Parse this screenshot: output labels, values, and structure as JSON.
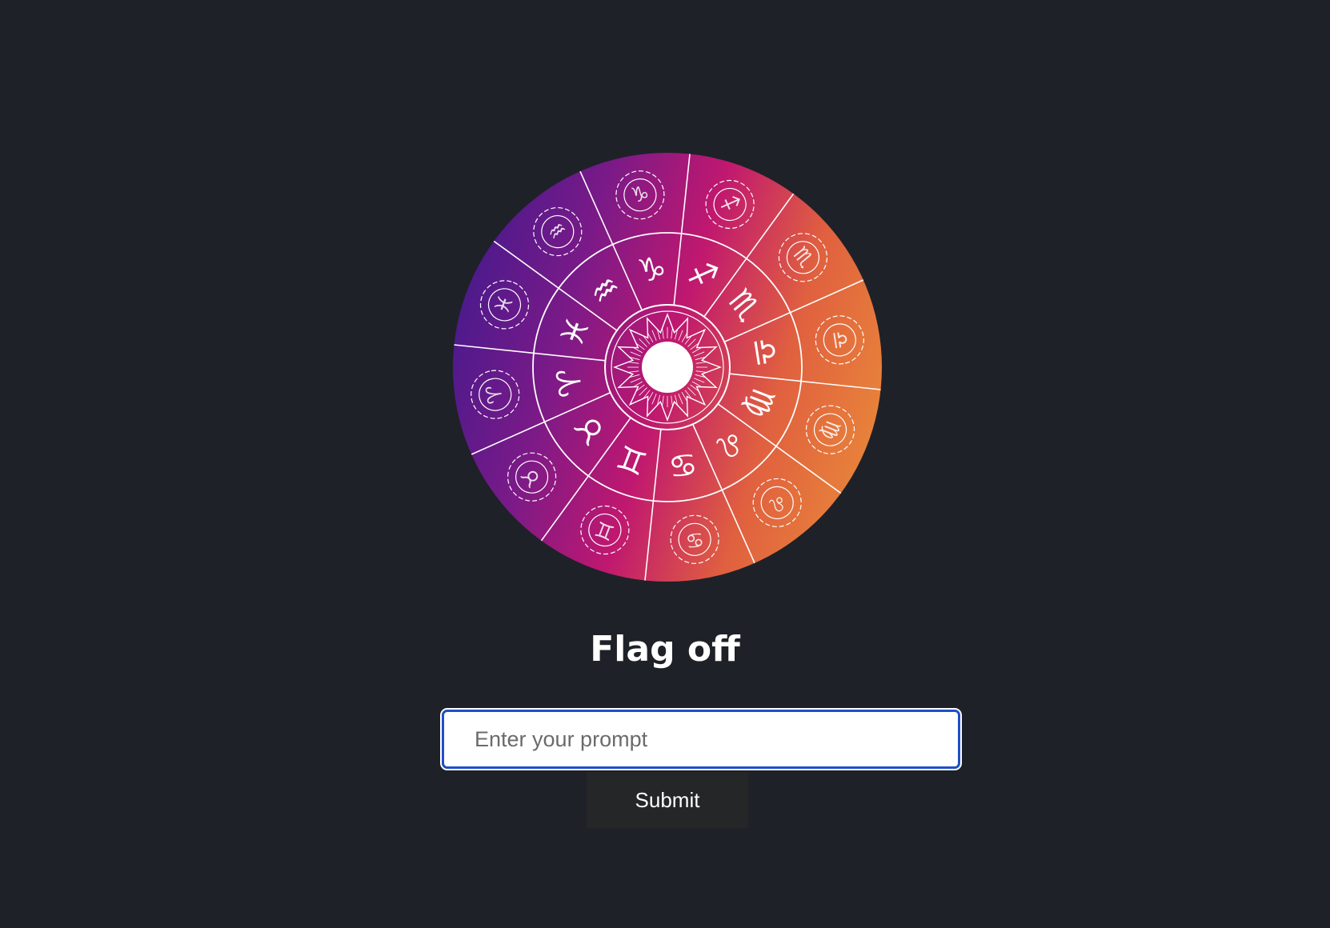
{
  "header": {
    "title": "Flag off"
  },
  "zodiac_wheel": {
    "icon": "zodiac-wheel-icon",
    "gradient_colors": [
      "#4a1a8c",
      "#7a1a88",
      "#c0186f",
      "#e0603f",
      "#e8843a"
    ],
    "signs": [
      {
        "name": "sagittarius",
        "glyph": "♐"
      },
      {
        "name": "scorpio",
        "glyph": "♏"
      },
      {
        "name": "libra",
        "glyph": "♎"
      },
      {
        "name": "virgo",
        "glyph": "♍"
      },
      {
        "name": "leo",
        "glyph": "♌"
      },
      {
        "name": "cancer",
        "glyph": "♋"
      },
      {
        "name": "gemini",
        "glyph": "♊"
      },
      {
        "name": "taurus",
        "glyph": "♉"
      },
      {
        "name": "aries",
        "glyph": "♈"
      },
      {
        "name": "pisces",
        "glyph": "♓"
      },
      {
        "name": "aquarius",
        "glyph": "♒"
      },
      {
        "name": "capricorn",
        "glyph": "♑"
      }
    ]
  },
  "form": {
    "prompt_placeholder": "Enter your prompt",
    "prompt_value": "",
    "submit_label": "Submit"
  }
}
